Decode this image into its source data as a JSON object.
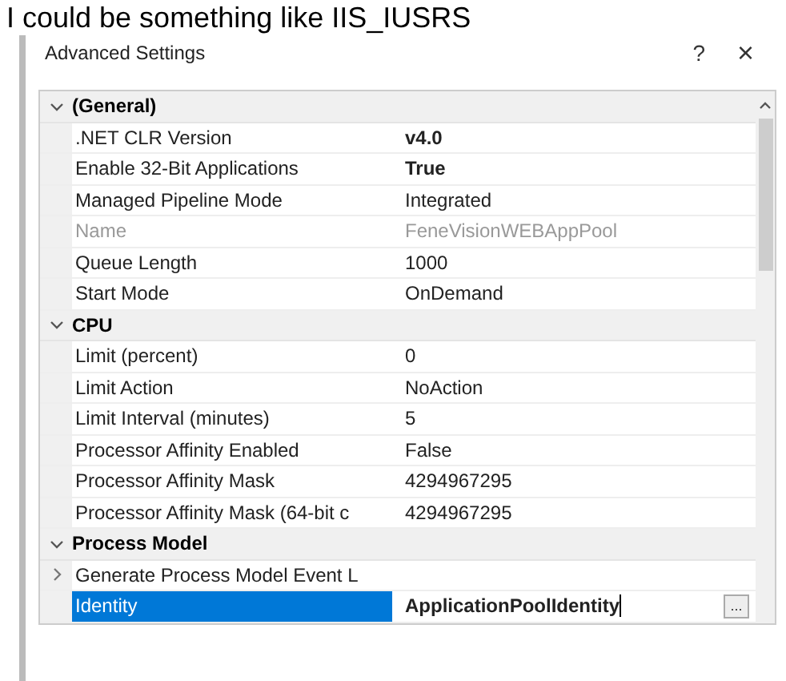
{
  "background_text": "I could be something like IIS_IUSRS",
  "window": {
    "title": "Advanced Settings",
    "help": "?",
    "close": "×"
  },
  "categories": [
    {
      "name": "(General)",
      "expanded": true,
      "properties": [
        {
          "kind": "plain",
          "label": ".NET CLR Version",
          "value": "v4.0",
          "bold": true,
          "disabled": false,
          "selected": false
        },
        {
          "kind": "plain",
          "label": "Enable 32-Bit Applications",
          "value": "True",
          "bold": true,
          "disabled": false,
          "selected": false
        },
        {
          "kind": "plain",
          "label": "Managed Pipeline Mode",
          "value": "Integrated",
          "bold": false,
          "disabled": false,
          "selected": false
        },
        {
          "kind": "plain",
          "label": "Name",
          "value": "FeneVisionWEBAppPool",
          "bold": false,
          "disabled": true,
          "selected": false
        },
        {
          "kind": "plain",
          "label": "Queue Length",
          "value": "1000",
          "bold": false,
          "disabled": false,
          "selected": false
        },
        {
          "kind": "plain",
          "label": "Start Mode",
          "value": "OnDemand",
          "bold": false,
          "disabled": false,
          "selected": false
        }
      ]
    },
    {
      "name": "CPU",
      "expanded": true,
      "properties": [
        {
          "kind": "plain",
          "label": "Limit (percent)",
          "value": "0",
          "bold": false,
          "disabled": false,
          "selected": false
        },
        {
          "kind": "plain",
          "label": "Limit Action",
          "value": "NoAction",
          "bold": false,
          "disabled": false,
          "selected": false
        },
        {
          "kind": "plain",
          "label": "Limit Interval (minutes)",
          "value": "5",
          "bold": false,
          "disabled": false,
          "selected": false
        },
        {
          "kind": "plain",
          "label": "Processor Affinity Enabled",
          "value": "False",
          "bold": false,
          "disabled": false,
          "selected": false
        },
        {
          "kind": "plain",
          "label": "Processor Affinity Mask",
          "value": "4294967295",
          "bold": false,
          "disabled": false,
          "selected": false
        },
        {
          "kind": "plain",
          "label": "Processor Affinity Mask (64-bit c",
          "value": "4294967295",
          "bold": false,
          "disabled": false,
          "selected": false
        }
      ]
    },
    {
      "name": "Process Model",
      "expanded": true,
      "properties": [
        {
          "kind": "group",
          "label": "Generate Process Model Event L",
          "expanded": false,
          "disabled": false,
          "selected": false
        },
        {
          "kind": "editing",
          "label": "Identity",
          "value": "ApplicationPoolIdentity",
          "button_label": "...",
          "bold": true,
          "disabled": false,
          "selected": true
        }
      ]
    }
  ]
}
